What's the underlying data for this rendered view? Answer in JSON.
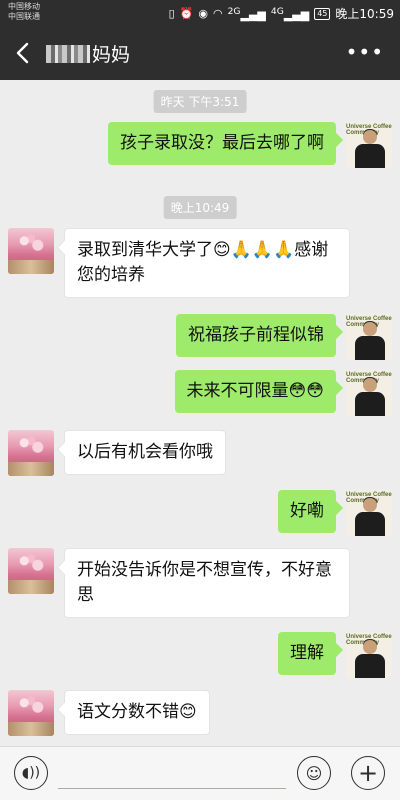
{
  "status_bar": {
    "carrier_1": "中国移动",
    "carrier_2": "中国联通",
    "network_1": "2G",
    "network_2": "4G",
    "battery": "45",
    "time": "晚上10:59"
  },
  "header": {
    "title": "妈妈"
  },
  "messages": [
    {
      "type": "time",
      "text": "昨天 下午3:51"
    },
    {
      "type": "sent",
      "text": "孩子录取没？最后去哪了啊"
    },
    {
      "type": "time",
      "text": "晚上10:49"
    },
    {
      "type": "received",
      "text": "录取到清华大学了😊🙏🙏🙏感谢您的培养"
    },
    {
      "type": "sent",
      "text": "祝福孩子前程似锦"
    },
    {
      "type": "sent",
      "text": "未来不可限量😳😳"
    },
    {
      "type": "received",
      "text": "以后有机会看你哦"
    },
    {
      "type": "sent",
      "text": "好嘞"
    },
    {
      "type": "received",
      "text": "开始没告诉你是不想宣传，不好意思"
    },
    {
      "type": "sent",
      "text": "理解"
    },
    {
      "type": "received",
      "text": "语文分数不错😊"
    }
  ],
  "avatar_right_text": "Universe Coffee Community",
  "input_bar": {
    "voice_icon": "voice-icon",
    "emoji_icon": "emoji-icon",
    "plus_icon": "plus-icon",
    "placeholder": ""
  },
  "colors": {
    "header_bg": "#2e2e2e",
    "chat_bg": "#ededed",
    "sent_bubble": "#9eea6a",
    "received_bubble": "#ffffff"
  }
}
